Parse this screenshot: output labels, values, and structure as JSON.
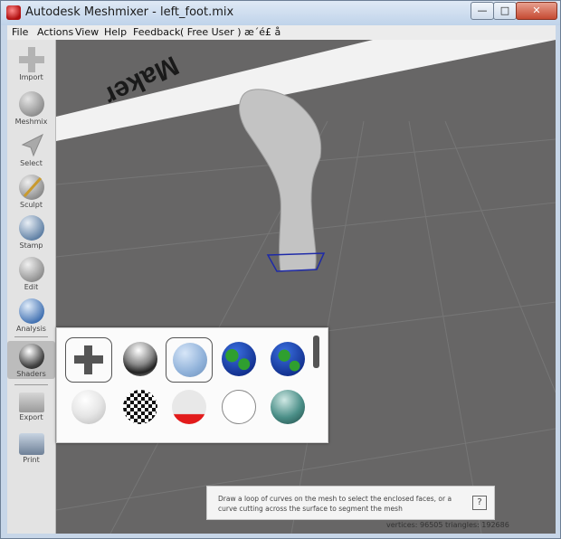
{
  "window": {
    "title": "Autodesk Meshmixer - left_foot.mix"
  },
  "window_controls": {
    "minimize": "—",
    "maximize": "□",
    "close": "✕"
  },
  "menu": [
    "File",
    "Actions",
    "View",
    "Help",
    "Feedback",
    "( Free User ) æ´é£ å"
  ],
  "sidebar": {
    "items": [
      {
        "label": "Import",
        "icon": "plus-icon"
      },
      {
        "label": "Meshmix",
        "icon": "meshmix-icon"
      },
      {
        "label": "Select",
        "icon": "select-arrow-icon"
      },
      {
        "label": "Sculpt",
        "icon": "sculpt-brush-icon"
      },
      {
        "label": "Stamp",
        "icon": "stamp-icon"
      },
      {
        "label": "Edit",
        "icon": "edit-icon"
      },
      {
        "label": "Analysis",
        "icon": "analysis-icon"
      },
      {
        "label": "Shaders",
        "icon": "shader-sphere-icon"
      },
      {
        "label": "Export",
        "icon": "export-folder-icon"
      },
      {
        "label": "Print",
        "icon": "print-icon"
      }
    ]
  },
  "viewport": {
    "platform_text": "Maker"
  },
  "shaders": [
    {
      "name": "add-shader",
      "icon": "plus-icon"
    },
    {
      "name": "chrome-shader",
      "icon": "chrome-sphere-icon"
    },
    {
      "name": "blue-matte-shader",
      "icon": "blue-sphere-icon",
      "selected": true
    },
    {
      "name": "earth-shader",
      "icon": "earth-icon"
    },
    {
      "name": "earth-shader-2",
      "icon": "earth-icon"
    },
    {
      "name": "white-gloss-shader",
      "icon": "white-sphere-icon"
    },
    {
      "name": "checker-shader",
      "icon": "checker-sphere-icon"
    },
    {
      "name": "overhang-shader",
      "icon": "red-white-sphere-icon"
    },
    {
      "name": "white-flat-shader",
      "icon": "white-flat-sphere-icon"
    },
    {
      "name": "teal-shader",
      "icon": "teal-sphere-icon"
    }
  ],
  "hint": {
    "text": "Draw a loop of curves on the mesh to select the enclosed faces, or a curve cutting across the surface to segment the mesh",
    "help": "?"
  },
  "status": {
    "stats": "vertices: 96505 triangles: 192686"
  }
}
